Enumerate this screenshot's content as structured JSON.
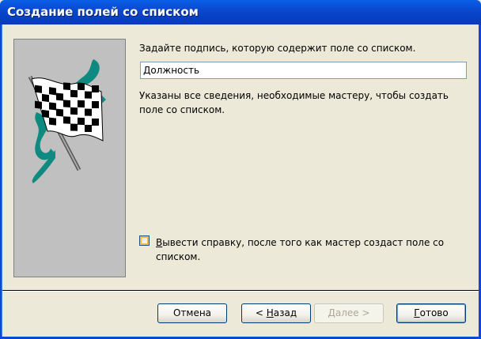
{
  "window": {
    "title": "Создание полей со списком"
  },
  "main": {
    "prompt": "Задайте подпись, которую содержит поле со списком.",
    "caption_value": "Должность",
    "info_text": "Указаны все сведения, необходимые мастеру, чтобы создать поле со списком.",
    "help_checkbox": {
      "checked": false,
      "label_accel": "В",
      "label_rest": "ывести справку, после того как мастер создаст поле со списком."
    }
  },
  "buttons": {
    "cancel": "Отмена",
    "back_prefix": "< ",
    "back_accel": "Н",
    "back_rest": "азад",
    "next_accel": "Д",
    "next_rest": "алее >",
    "finish_accel": "Г",
    "finish_rest": "отово"
  },
  "colors": {
    "titlebar": "#0a49d0",
    "dialog_bg": "#ece9d8",
    "image_panel_bg": "#c0c0c0",
    "accent_teal": "#0f8a80"
  }
}
